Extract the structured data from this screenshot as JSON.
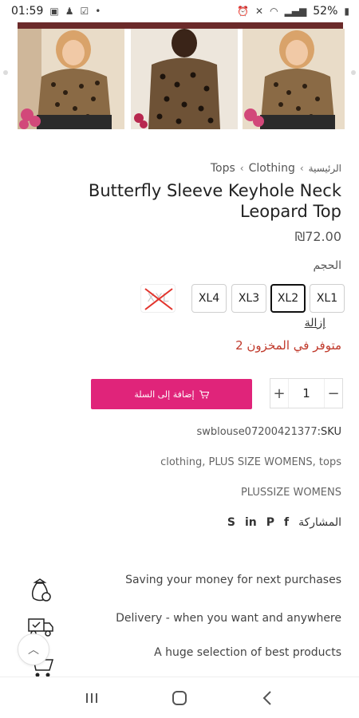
{
  "status_bar": {
    "time": "01:59",
    "battery": "52%"
  },
  "breadcrumb": {
    "items": [
      "Tops",
      "Clothing",
      "الرئيسية"
    ]
  },
  "product": {
    "title": "Butterfly Sleeve Keyhole Neck Leopard Top",
    "price": "₪72.00",
    "size_label": "الحجم",
    "sizes": [
      {
        "label": "XXL",
        "state": "disabled"
      },
      {
        "label": "XL4",
        "state": "available"
      },
      {
        "label": "XL3",
        "state": "available"
      },
      {
        "label": "XL2",
        "state": "selected"
      },
      {
        "label": "XL1",
        "state": "available"
      }
    ],
    "clear_label": "إزالة",
    "stock_text": "2 متوفر في المخزون",
    "quantity": "1",
    "qty_minus": "−",
    "qty_plus": "+",
    "add_to_cart_label": "إضافة إلى السلة",
    "sku_value": "swblouse07200421377",
    "sku_label": ":SKU",
    "tags": "clothing, PLUS SIZE WOMENS, tops",
    "brand": "PLUSSIZE WOMENS",
    "share_label": "المشاركة",
    "share_icons": [
      "f",
      "P",
      "in",
      "S"
    ]
  },
  "features": [
    {
      "text": "Saving your money for next purchases",
      "icon": "money-bag-icon"
    },
    {
      "text": "Delivery - when you want and anywhere",
      "icon": "delivery-truck-icon"
    },
    {
      "text": "A huge selection of best products",
      "icon": "shopping-cart-icon"
    }
  ],
  "colors": {
    "accent": "#e0247a",
    "stock": "#c0392b"
  }
}
